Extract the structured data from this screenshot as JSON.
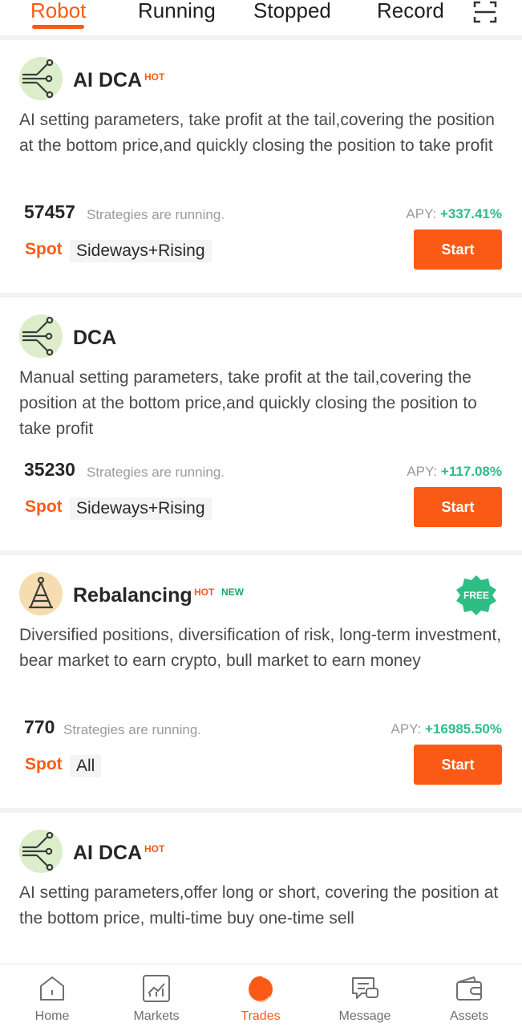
{
  "tabs": [
    {
      "label": "Robot",
      "active": true
    },
    {
      "label": "Running",
      "active": false
    },
    {
      "label": "Stopped",
      "active": false
    },
    {
      "label": "Record",
      "active": false
    }
  ],
  "scan_icon": "scan-icon",
  "cards": [
    {
      "icon": "branch-icon",
      "title": "AI DCA",
      "badges": [
        "HOT"
      ],
      "description": "AI setting parameters, take profit at the tail,covering the position at the bottom price,and quickly closing the position to take profit",
      "count": "57457",
      "count_label": "Strategies are running.",
      "apy_label": "APY:",
      "apy_value": "+337.41%",
      "market": "Spot",
      "tag": "Sideways+Rising",
      "button": "Start"
    },
    {
      "icon": "branch-icon",
      "title": "DCA",
      "badges": [],
      "description": "Manual setting parameters, take profit at the tail,covering the position at the bottom price,and quickly closing the position to take profit",
      "count": "35230",
      "count_label": "Strategies are running.",
      "apy_label": "APY:",
      "apy_value": "+117.08%",
      "market": "Spot",
      "tag": "Sideways+Rising",
      "button": "Start"
    },
    {
      "icon": "pyramid-icon",
      "title": "Rebalancing",
      "badges": [
        "HOT",
        "NEW"
      ],
      "corner_badge": "FREE",
      "description": "Diversified positions, diversification of risk, long-term investment, bear market to earn crypto, bull market to earn money",
      "count": "770",
      "count_label": "Strategies are running.",
      "apy_label": "APY:",
      "apy_value": "+16985.50%",
      "market": "Spot",
      "tag": "All",
      "button": "Start"
    },
    {
      "icon": "branch-icon",
      "title": "AI DCA",
      "badges": [
        "HOT"
      ],
      "description": "AI setting parameters,offer long or short, covering the position at the bottom price, multi-time buy one-time sell"
    }
  ],
  "bottom_nav": [
    {
      "label": "Home",
      "icon": "home-icon",
      "active": false
    },
    {
      "label": "Markets",
      "icon": "markets-icon",
      "active": false
    },
    {
      "label": "Trades",
      "icon": "trades-icon",
      "active": true
    },
    {
      "label": "Message",
      "icon": "message-icon",
      "active": false
    },
    {
      "label": "Assets",
      "icon": "wallet-icon",
      "active": false
    }
  ],
  "colors": {
    "accent": "#fb5a16",
    "positive": "#2ebd85",
    "new_badge": "#1aa866",
    "avatar_green": "#dcedca",
    "avatar_tan": "#f6ddb1"
  }
}
